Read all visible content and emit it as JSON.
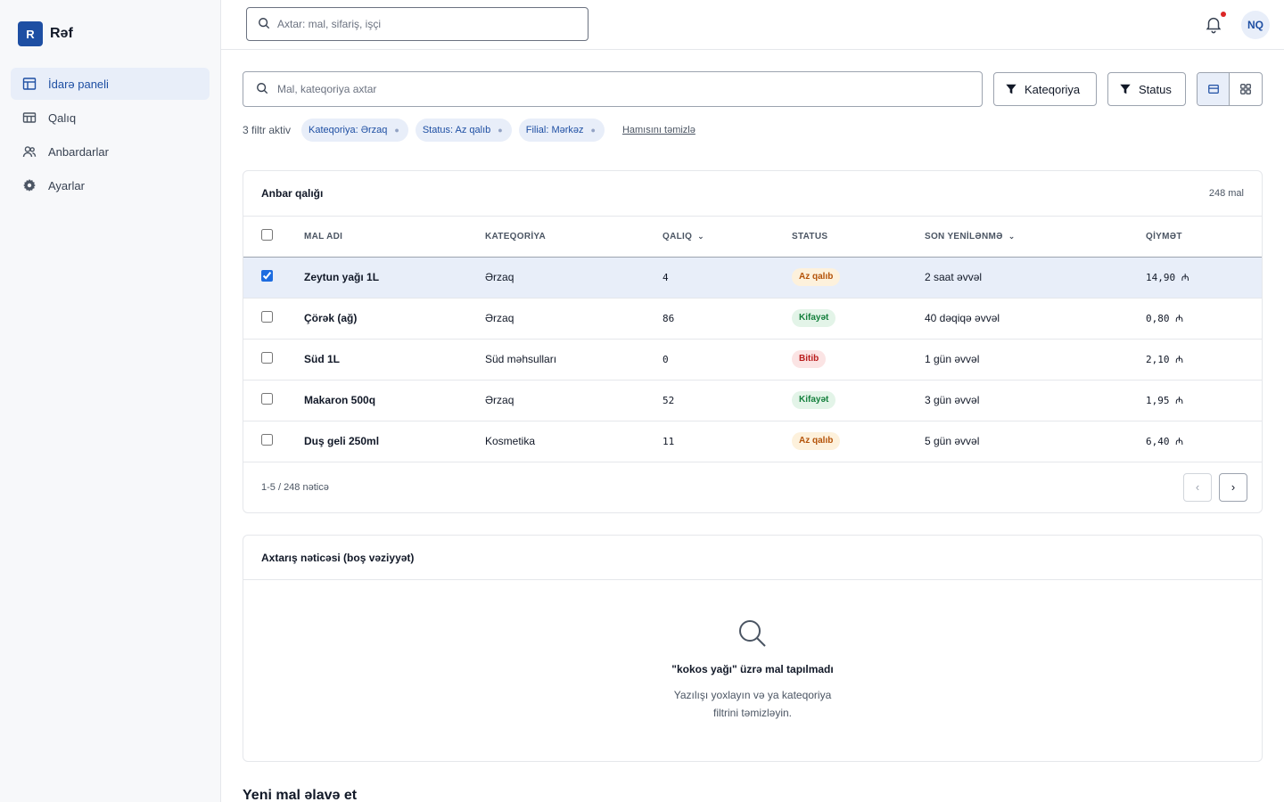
{
  "brand": {
    "logo_letter": "R",
    "name": "Rəf"
  },
  "sidebar": {
    "items": [
      {
        "label": "İdarə paneli",
        "icon": "layout-icon",
        "active": true
      },
      {
        "label": "Qalıq",
        "icon": "table-icon",
        "active": false
      },
      {
        "label": "Anbardarlar",
        "icon": "users-icon",
        "active": false
      },
      {
        "label": "Ayarlar",
        "icon": "gear-icon",
        "active": false
      }
    ]
  },
  "topbar": {
    "search_placeholder": "Axtar: mal, sifariş, işçi",
    "avatar_initials": "NQ"
  },
  "filters": {
    "search_placeholder": "Mal, kateqoriya axtar",
    "category_button": "Kateqoriya",
    "status_button": "Status",
    "active_count": "3 filtr aktiv",
    "chips": [
      "Kateqoriya: Ərzaq",
      "Status: Az qalıb",
      "Filial: Mərkəz"
    ],
    "clear_all": "Hamısını təmizlə"
  },
  "inventory": {
    "title": "Anbar qalığı",
    "total": "248 mal",
    "columns": {
      "name": "MAL ADI",
      "category": "KATEQORİYA",
      "stock": "QALIQ",
      "status": "STATUS",
      "updated": "SON YENİLƏNMƏ",
      "price": "QİYMƏT"
    },
    "rows": [
      {
        "name": "Zeytun yağı 1L",
        "category": "Ərzaq",
        "stock": "4",
        "status": "Az qalıb",
        "status_kind": "low",
        "updated": "2 saat əvvəl",
        "price": "14,90 ₼",
        "selected": true
      },
      {
        "name": "Çörək (ağ)",
        "category": "Ərzaq",
        "stock": "86",
        "status": "Kifayət",
        "status_kind": "ok",
        "updated": "40 dəqiqə əvvəl",
        "price": "0,80 ₼",
        "selected": false
      },
      {
        "name": "Süd 1L",
        "category": "Süd məhsulları",
        "stock": "0",
        "status": "Bitib",
        "status_kind": "out",
        "updated": "1 gün əvvəl",
        "price": "2,10 ₼",
        "selected": false
      },
      {
        "name": "Makaron 500q",
        "category": "Ərzaq",
        "stock": "52",
        "status": "Kifayət",
        "status_kind": "ok",
        "updated": "3 gün əvvəl",
        "price": "1,95 ₼",
        "selected": false
      },
      {
        "name": "Duş geli 250ml",
        "category": "Kosmetika",
        "stock": "11",
        "status": "Az qalıb",
        "status_kind": "low",
        "updated": "5 gün əvvəl",
        "price": "6,40 ₼",
        "selected": false
      }
    ],
    "footer_text": "1-5 / 248 nəticə",
    "prev": "‹",
    "next": "›"
  },
  "empty_state": {
    "title": "Axtarış nəticəsi (boş vəziyyət)",
    "message": "\"kokos yağı\" üzrə mal tapılmadı",
    "hint": "Yazılışı yoxlayın və ya kateqoriya filtrini təmizləyin."
  },
  "next_section": {
    "title": "Yeni mal əlavə et"
  },
  "colors": {
    "accent": "#1e4fa3",
    "accent_bg": "#e8eef9",
    "low": "#b45309",
    "ok": "#15803d",
    "out": "#b91c1c"
  }
}
